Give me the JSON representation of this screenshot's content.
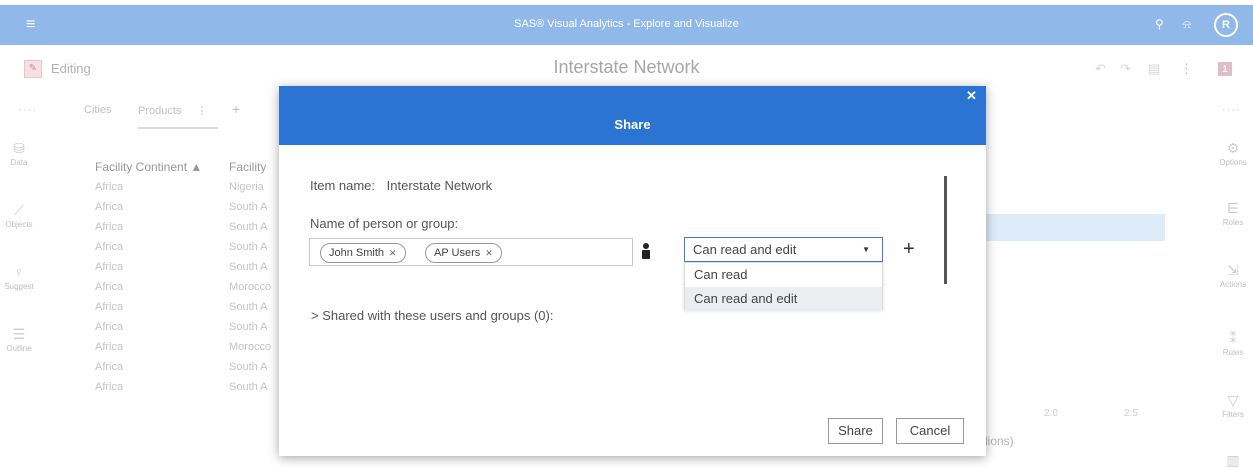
{
  "app": {
    "title": "SAS® Visual Analytics - Explore and Visualize",
    "avatar": "R"
  },
  "editbar": {
    "mode": "Editing",
    "report_title": "Interstate Network",
    "badge": "1"
  },
  "tabs": [
    {
      "label": "Cities"
    },
    {
      "label": "Products"
    }
  ],
  "left_rail": [
    {
      "label": "Data",
      "icon": "database-icon",
      "glyph": "⛁"
    },
    {
      "label": "Objects",
      "icon": "line-chart-icon",
      "glyph": "⟋"
    },
    {
      "label": "Suggest",
      "icon": "lightbulb-icon",
      "glyph": "♀"
    },
    {
      "label": "Outline",
      "icon": "outline-list-icon",
      "glyph": "☰"
    }
  ],
  "right_rail": [
    {
      "label": "Options",
      "icon": "options-icon",
      "glyph": "⚙"
    },
    {
      "label": "Roles",
      "icon": "roles-icon",
      "glyph": "⋿"
    },
    {
      "label": "Actions",
      "icon": "actions-icon",
      "glyph": "⇲"
    },
    {
      "label": "Rules",
      "icon": "rules-icon",
      "glyph": "⁑"
    },
    {
      "label": "Filters",
      "icon": "filter-icon",
      "glyph": "▽"
    },
    {
      "label": "",
      "icon": "ranks-icon",
      "glyph": "▥"
    }
  ],
  "table": {
    "headers": [
      "Facility Continent ▲",
      "Facility"
    ],
    "rows": [
      [
        "Africa",
        "Nigeria"
      ],
      [
        "Africa",
        "South A"
      ],
      [
        "Africa",
        "South A"
      ],
      [
        "Africa",
        "South A"
      ],
      [
        "Africa",
        "South A"
      ],
      [
        "Africa",
        "Morocco"
      ],
      [
        "Africa",
        "South A"
      ],
      [
        "Africa",
        "South A"
      ],
      [
        "Africa",
        "Morocco"
      ],
      [
        "Africa",
        "South A"
      ],
      [
        "Africa",
        "South A"
      ]
    ]
  },
  "chart": {
    "ticks": [
      "2.0",
      "2.5"
    ],
    "axis_label_fragment": "lions)"
  },
  "dialog": {
    "title": "Share",
    "item_name_label": "Item name:",
    "item_name_value": "Interstate Network",
    "person_label": "Name of person or group:",
    "chips": [
      "John Smith",
      "AP Users"
    ],
    "permission_selected": "Can read and edit",
    "permission_options": [
      "Can read",
      "Can read and edit"
    ],
    "highlighted_option": "Can read and edit",
    "add_symbol": "+",
    "shared_summary": "> Shared with these users and groups (0):",
    "share_button": "Share",
    "cancel_button": "Cancel",
    "header_color": "#2c74d4"
  }
}
